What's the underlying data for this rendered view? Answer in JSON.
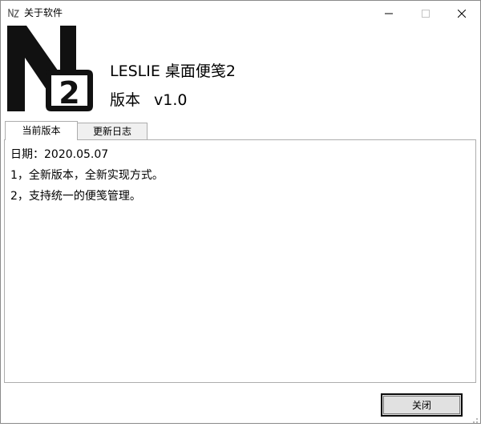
{
  "window": {
    "title": "关于软件",
    "icons": {
      "app": "app-icon",
      "minimize": "minimize-icon",
      "maximize": "maximize-icon",
      "close": "close-icon"
    }
  },
  "product": {
    "name": "LESLIE 桌面便笺2",
    "version_label": "版本",
    "version_value": "v1.0",
    "logo_icon": "n2-logo-icon",
    "logo_text": "2"
  },
  "tabs": [
    {
      "label": "当前版本",
      "selected": true
    },
    {
      "label": "更新日志",
      "selected": false
    }
  ],
  "release_notes": [
    "日期：2020.05.07",
    "1，全新版本，全新实现方式。",
    "2，支持统一的便笺管理。"
  ],
  "footer": {
    "close_label": "关闭"
  }
}
